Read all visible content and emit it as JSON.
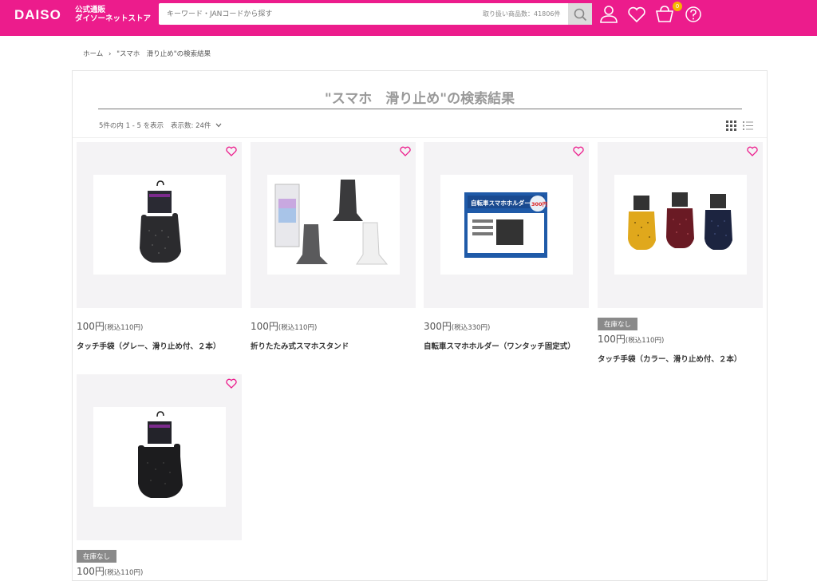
{
  "header": {
    "logo": "DAISO",
    "logo_sub_1": "公式通販",
    "logo_sub_2": "ダイソーネットストア",
    "search_placeholder": "キーワード・JANコードから探す",
    "search_count": "取り扱い商品数：41806件",
    "cart_count": "0",
    "colors": {
      "brand": "#ec1c8c"
    }
  },
  "breadcrumb": {
    "home": "ホーム",
    "separator": "›",
    "current": "\"スマホ　滑り止め\"の検索結果"
  },
  "results": {
    "title": "\"スマホ　滑り止め\"の検索結果",
    "info": "5件の内 1 - 5 を表示",
    "per_page": "表示数: 24件",
    "per_page_icon": "chevron-down-icon"
  },
  "products": [
    {
      "price": "100円",
      "tax": "(税込110円)",
      "name": "タッチ手袋（グレー、滑り止め付、２本）",
      "stock": ""
    },
    {
      "price": "100円",
      "tax": "(税込110円)",
      "name": "折りたたみ式スマホスタンド",
      "stock": ""
    },
    {
      "price": "300円",
      "tax": "(税込330円)",
      "name": "自転車スマホホルダー（ワンタッチ固定式）",
      "stock": ""
    },
    {
      "price": "100円",
      "tax": "(税込110円)",
      "name": "タッチ手袋（カラー、滑り止め付、２本）",
      "stock": "在庫なし"
    },
    {
      "price": "100円",
      "tax": "(税込110円)",
      "name": "",
      "stock": "在庫なし"
    }
  ],
  "box_labels": {
    "holder": "自転車スマホホルダー",
    "badge": "300円"
  }
}
